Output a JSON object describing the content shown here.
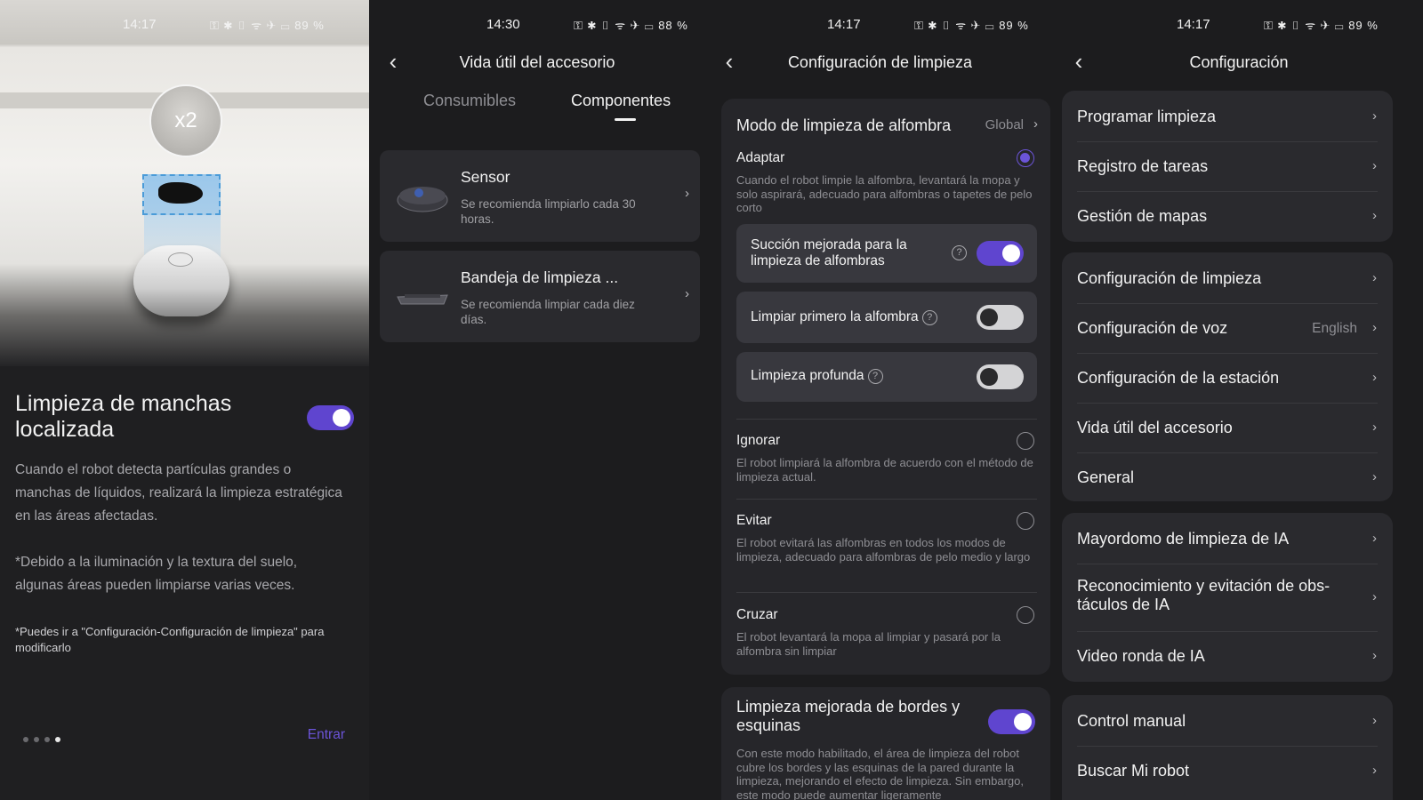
{
  "panel1": {
    "status": {
      "time": "14:17",
      "battery": "89 %"
    },
    "badge": "x2",
    "title": "Limpieza de manchas localizada",
    "toggle_on": true,
    "description": "Cuando el robot detecta partículas grandes o manchas de líquidos, realizará la limpieza estratégica en las áreas afectadas.",
    "note": "*Debido a la iluminación y la textura del suelo, algunas áreas pueden limpiarse varias veces.",
    "note2": "*Puedes ir a \"Configuración-Configuración de limpieza\" para modificarlo",
    "pager": {
      "count": 4,
      "active_index": 3
    },
    "enter_label": "Entrar",
    "accent": "#6b54d8"
  },
  "panel2": {
    "status": {
      "time": "14:30",
      "battery": "88 %"
    },
    "title": "Vida útil del accesorio",
    "tabs": [
      {
        "label": "Consumibles",
        "active": false
      },
      {
        "label": "Componentes",
        "active": true
      }
    ],
    "items": [
      {
        "name": "Sensor",
        "desc": "Se recomienda limpiarlo cada 30 horas."
      },
      {
        "name": "Bandeja de limpieza ...",
        "desc": "Se recomienda limpiar cada diez días."
      }
    ]
  },
  "panel3": {
    "status": {
      "time": "14:17",
      "battery": "89 %"
    },
    "title": "Configuración de limpieza",
    "carpet_mode": {
      "label": "Modo de limpieza de alfombra",
      "value": "Global"
    },
    "options": [
      {
        "title": "Adaptar",
        "desc": "Cuando el robot limpie la alfombra, levantará la mopa y solo aspirará, adecuado para alfombras o tapetes de pelo corto",
        "selected": true
      },
      {
        "title": "Ignorar",
        "desc": "El robot limpiará la alfombra de acuerdo con el método de limpieza actual.",
        "selected": false
      },
      {
        "title": "Evitar",
        "desc": "El robot evitará las alfombras en todos los modos de limpieza, adecuado para alfombras de pelo medio y largo",
        "selected": false
      },
      {
        "title": "Cruzar",
        "desc": "El robot levantará la mopa al limpiar y pasará por la alfombra sin limpiar",
        "selected": false
      }
    ],
    "sub_toggles": [
      {
        "label": "Succión mejorada para la limpieza de alfombras",
        "on": true
      },
      {
        "label": "Limpiar primero la alfombra",
        "on": false
      },
      {
        "label": "Limpieza profunda",
        "on": false
      }
    ],
    "help_glyph": "?",
    "edge": {
      "title": "Limpieza mejorada de bordes y esquinas",
      "on": true,
      "desc": "Con este modo habilitado, el área de limpieza del robot cubre los bordes y las esquinas de la pared durante la limpieza, mejorando el efecto de limpieza. Sin embargo, este modo puede aumentar ligeramente"
    }
  },
  "panel4": {
    "status": {
      "time": "14:17",
      "battery": "89 %"
    },
    "title": "Configuración",
    "groups": [
      [
        {
          "label": "Programar limpieza"
        },
        {
          "label": "Registro de tareas"
        },
        {
          "label": "Gestión de mapas"
        }
      ],
      [
        {
          "label": "Configuración de limpieza"
        },
        {
          "label": "Configuración de voz",
          "value": "English"
        },
        {
          "label": "Configuración de la estación"
        },
        {
          "label": "Vida útil del accesorio"
        },
        {
          "label": "General"
        }
      ],
      [
        {
          "label": "Mayordomo de limpieza de IA"
        },
        {
          "label": "Reconocimiento y evitación de obs-táculos de IA"
        },
        {
          "label": "Video ronda de IA"
        }
      ],
      [
        {
          "label": "Control manual"
        },
        {
          "label": "Buscar Mi robot"
        }
      ]
    ]
  },
  "icons": {
    "back": "‹",
    "chevron": "›",
    "status_glyphs": "⚿ ✱ ▯ ᯤ ✈ ▭"
  }
}
